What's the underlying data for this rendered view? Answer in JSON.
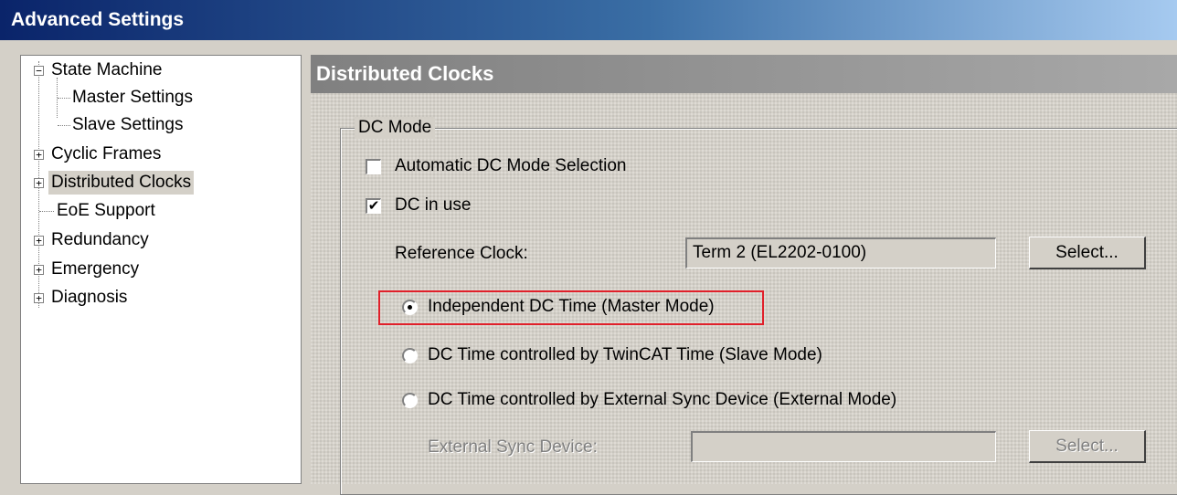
{
  "window": {
    "title": "Advanced Settings"
  },
  "tree": {
    "items": [
      {
        "label": "State Machine",
        "expander": "−"
      },
      {
        "label": "Master Settings"
      },
      {
        "label": "Slave Settings"
      },
      {
        "label": "Cyclic Frames",
        "expander": "+"
      },
      {
        "label": "Distributed Clocks",
        "expander": "+"
      },
      {
        "label": "EoE Support"
      },
      {
        "label": "Redundancy",
        "expander": "+"
      },
      {
        "label": "Emergency",
        "expander": "+"
      },
      {
        "label": "Diagnosis",
        "expander": "+"
      }
    ]
  },
  "panel": {
    "title": "Distributed Clocks",
    "group_label": "DC Mode",
    "auto_dc": {
      "label": "Automatic DC Mode Selection",
      "checked": false,
      "mark": ""
    },
    "dc_in_use": {
      "label": "DC in use",
      "checked": true,
      "mark": "✔"
    },
    "reference_clock": {
      "label": "Reference Clock:",
      "value": "Term 2 (EL2202-0100)",
      "button": "Select..."
    },
    "radios": [
      {
        "label": "Independent DC Time (Master Mode)",
        "selected": true
      },
      {
        "label": "DC Time controlled by TwinCAT Time (Slave Mode)",
        "selected": false
      },
      {
        "label": "DC Time controlled by External Sync Device (External Mode)",
        "selected": false
      }
    ],
    "external_sync": {
      "label": "External Sync Device:",
      "value": "",
      "button": "Select..."
    }
  },
  "colors": {
    "highlight": "#e0202a",
    "title_bar": "#0a246a"
  }
}
